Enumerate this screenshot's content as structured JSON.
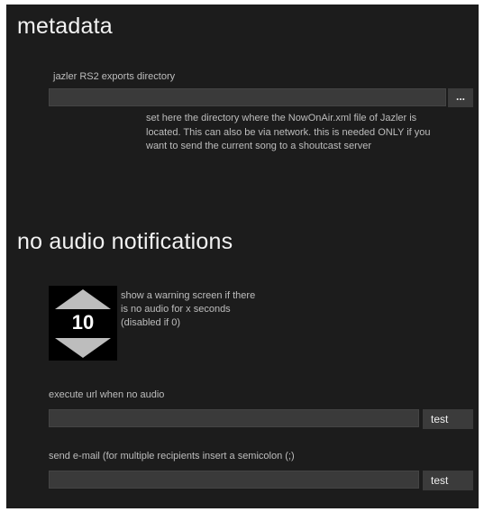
{
  "metadata": {
    "title": "metadata",
    "exports_label": "jazler RS2 exports directory",
    "exports_value": "",
    "browse_label": "...",
    "help": "set here the directory where the NowOnAir.xml file of Jazler is\nlocated. This can also be via network. this is needed ONLY if you\nwant to send the current song to a shoutcast server"
  },
  "no_audio": {
    "title": "no audio notifications",
    "seconds_value": "10",
    "warning_help": "show a warning screen if there\nis no audio for x seconds\n(disabled if 0)",
    "url_label": "execute url when no audio",
    "url_value": "",
    "url_test_label": "test",
    "email_label": "send e-mail (for multiple recipients insert a semicolon (;)",
    "email_value": "",
    "email_test_label": "test"
  },
  "icons": {
    "up": "triangle-up",
    "down": "triangle-down"
  },
  "colors": {
    "panel_bg": "#1c1c1c",
    "field_bg": "#3a3a3a",
    "button_bg": "#3b3b3b",
    "text": "#bdbdbd",
    "heading": "#f2f2f2"
  }
}
